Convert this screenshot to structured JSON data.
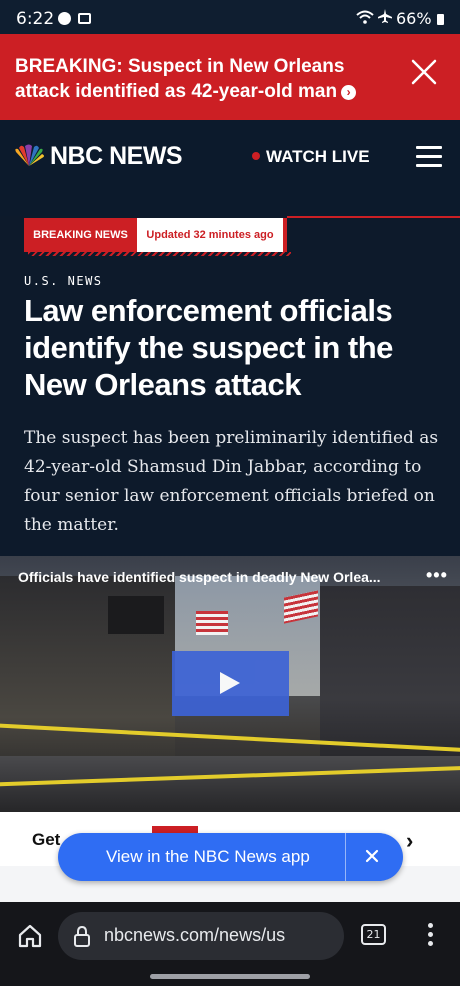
{
  "status_bar": {
    "time": "6:22",
    "battery": "66%"
  },
  "alert": {
    "text": "BREAKING: Suspect in New Orleans attack identified as 42-year-old man"
  },
  "header": {
    "logo_text": "NBC NEWS",
    "watch_live": "WATCH LIVE"
  },
  "article": {
    "badge_breaking": "BREAKING NEWS",
    "badge_updated": "Updated 32 minutes ago",
    "section": "U.S. NEWS",
    "headline": "Law enforcement officials identify the suspect in the New Orleans attack",
    "dek": "The suspect has been preliminarily identified as 42-year-old Shamsud Din Jabbar, according to four senior law enforcement officials briefed on the matter."
  },
  "video": {
    "title": "Officials have identified suspect in deadly New Orlea...",
    "more_label": "•••"
  },
  "teaser": {
    "text": "Get",
    "arrow": "›"
  },
  "app_banner": {
    "label": "View in the NBC News app"
  },
  "browser": {
    "url": "nbcnews.com/news/us",
    "tab_count": "21"
  },
  "colors": {
    "brand_red": "#cc1f24",
    "navy": "#0d1a2b",
    "app_blue": "#2f6df3"
  }
}
